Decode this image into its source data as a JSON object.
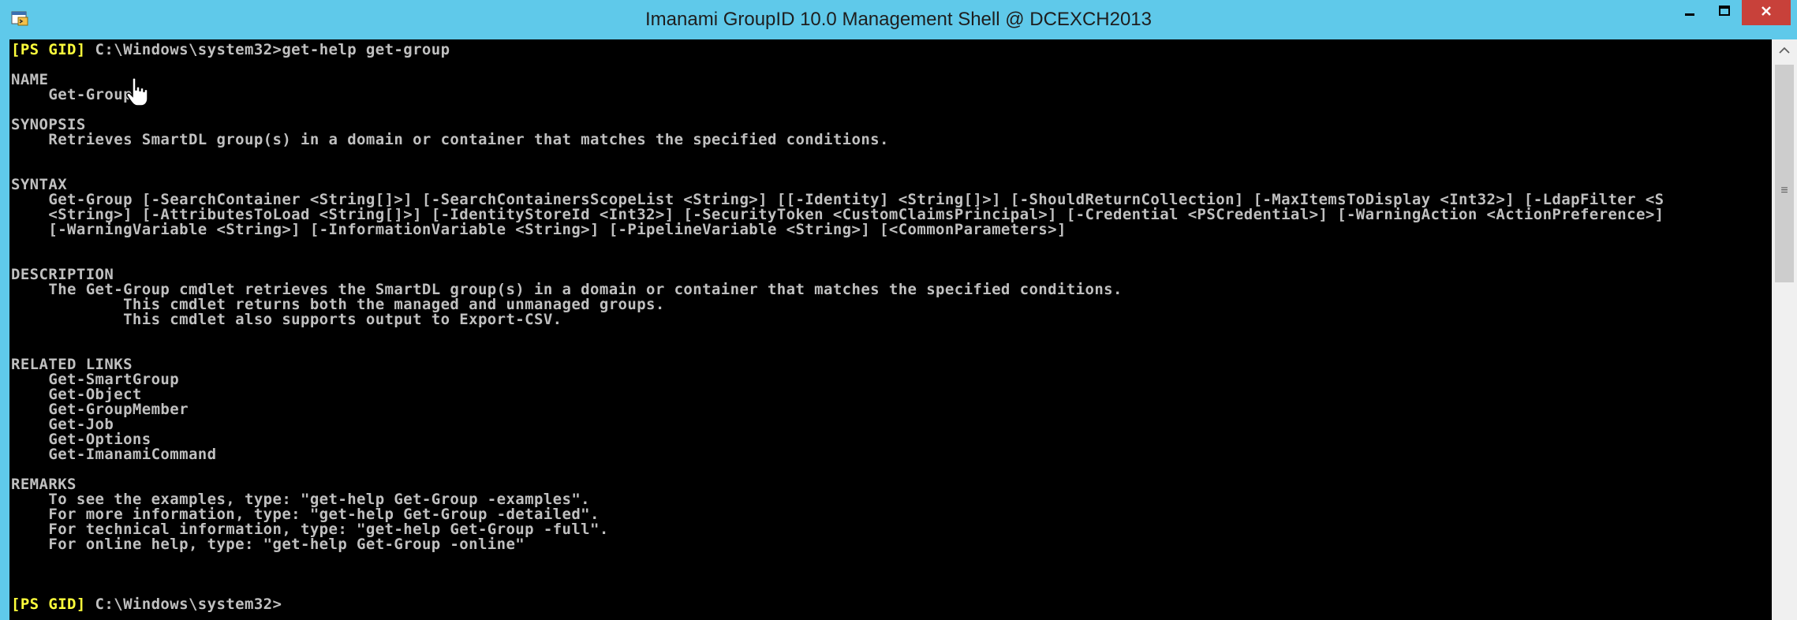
{
  "window": {
    "title": "Imanami GroupID 10.0 Management Shell @ DCEXCH2013",
    "controls": {
      "minimize": "minimize-icon",
      "maximize": "maximize-icon",
      "close": "close-icon"
    },
    "icon": "powershell-app-icon"
  },
  "console": {
    "lines": [
      {
        "prompt": "[PS GID]",
        "text": " C:\\Windows\\system32>get-help get-group"
      },
      {
        "prompt": "",
        "text": ""
      },
      {
        "prompt": "",
        "text": "NAME"
      },
      {
        "prompt": "",
        "text": "    Get-Group"
      },
      {
        "prompt": "",
        "text": ""
      },
      {
        "prompt": "",
        "text": "SYNOPSIS"
      },
      {
        "prompt": "",
        "text": "    Retrieves SmartDL group(s) in a domain or container that matches the specified conditions."
      },
      {
        "prompt": "",
        "text": ""
      },
      {
        "prompt": "",
        "text": ""
      },
      {
        "prompt": "",
        "text": "SYNTAX"
      },
      {
        "prompt": "",
        "text": "    Get-Group [-SearchContainer <String[]>] [-SearchContainersScopeList <String>] [[-Identity] <String[]>] [-ShouldReturnCollection] [-MaxItemsToDisplay <Int32>] [-LdapFilter <S"
      },
      {
        "prompt": "",
        "text": "    <String>] [-AttributesToLoad <String[]>] [-IdentityStoreId <Int32>] [-SecurityToken <CustomClaimsPrincipal>] [-Credential <PSCredential>] [-WarningAction <ActionPreference>]"
      },
      {
        "prompt": "",
        "text": "    [-WarningVariable <String>] [-InformationVariable <String>] [-PipelineVariable <String>] [<CommonParameters>]"
      },
      {
        "prompt": "",
        "text": ""
      },
      {
        "prompt": "",
        "text": ""
      },
      {
        "prompt": "",
        "text": "DESCRIPTION"
      },
      {
        "prompt": "",
        "text": "    The Get-Group cmdlet retrieves the SmartDL group(s) in a domain or container that matches the specified conditions."
      },
      {
        "prompt": "",
        "text": "            This cmdlet returns both the managed and unmanaged groups."
      },
      {
        "prompt": "",
        "text": "            This cmdlet also supports output to Export-CSV."
      },
      {
        "prompt": "",
        "text": ""
      },
      {
        "prompt": "",
        "text": ""
      },
      {
        "prompt": "",
        "text": "RELATED LINKS"
      },
      {
        "prompt": "",
        "text": "    Get-SmartGroup"
      },
      {
        "prompt": "",
        "text": "    Get-Object"
      },
      {
        "prompt": "",
        "text": "    Get-GroupMember"
      },
      {
        "prompt": "",
        "text": "    Get-Job"
      },
      {
        "prompt": "",
        "text": "    Get-Options"
      },
      {
        "prompt": "",
        "text": "    Get-ImanamiCommand"
      },
      {
        "prompt": "",
        "text": ""
      },
      {
        "prompt": "",
        "text": "REMARKS"
      },
      {
        "prompt": "",
        "text": "    To see the examples, type: \"get-help Get-Group -examples\"."
      },
      {
        "prompt": "",
        "text": "    For more information, type: \"get-help Get-Group -detailed\"."
      },
      {
        "prompt": "",
        "text": "    For technical information, type: \"get-help Get-Group -full\"."
      },
      {
        "prompt": "",
        "text": "    For online help, type: \"get-help Get-Group -online\""
      },
      {
        "prompt": "",
        "text": ""
      },
      {
        "prompt": "",
        "text": ""
      },
      {
        "prompt": "",
        "text": ""
      },
      {
        "prompt": "[PS GID]",
        "text": " C:\\Windows\\system32>"
      }
    ]
  },
  "scrollbar": {
    "up_arrow": "scroll-up-arrow-icon",
    "grip": "≡"
  },
  "pointer": "hand-cursor-icon",
  "colors": {
    "titlebar": "#5fc9ea",
    "console_bg": "#000000",
    "console_text": "#c0c0c0",
    "prompt": "#ffff3c",
    "close_button": "#c8413a"
  }
}
